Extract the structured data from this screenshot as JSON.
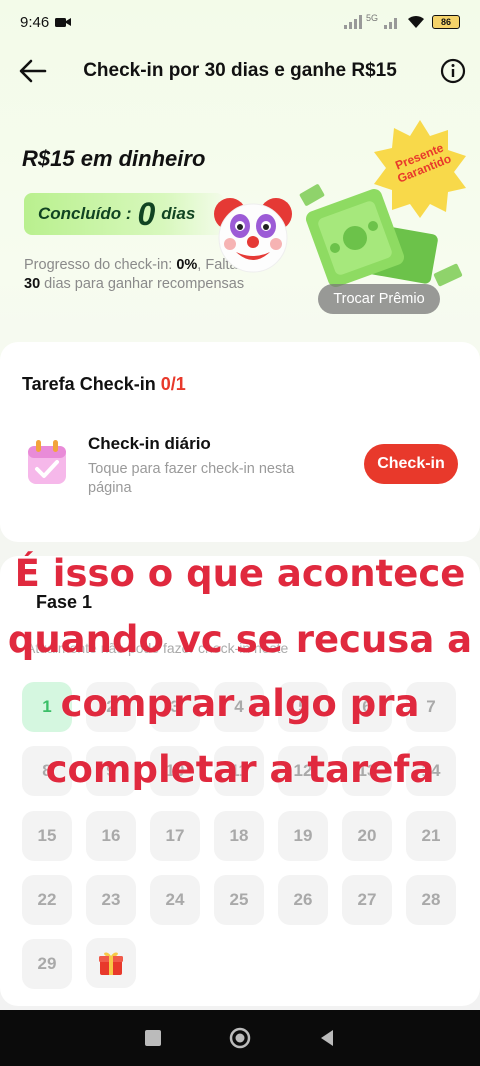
{
  "status_bar": {
    "time": "9:46",
    "battery": "86",
    "network": "5G"
  },
  "header": {
    "title": "Check-in por 30 dias e ganhe R$15"
  },
  "reward": {
    "title": "R$15 em dinheiro",
    "completed_label": "Concluído :",
    "completed_value": "0",
    "completed_unit": "dias",
    "progress_prefix": "Progresso do check-in:",
    "progress_value": "0%",
    "progress_suffix1": ", Faltam",
    "days_left": "30",
    "progress_suffix2": "dias para ganhar recompensas",
    "badge_line1": "Presente",
    "badge_line2": "Garantido",
    "trade_button": "Trocar Prêmio"
  },
  "task": {
    "title": "Tarefa Check-in",
    "count": "0/1",
    "name": "Check-in diário",
    "desc": "Toque para fazer check-in nesta página",
    "button": "Check-in"
  },
  "phase": {
    "title": "Fase 1",
    "note": "Atualmente não pode fazer check-in neste"
  },
  "days": [
    "1",
    "2",
    "3",
    "4",
    "5",
    "6",
    "7",
    "8",
    "9",
    "10",
    "11",
    "12",
    "13",
    "14",
    "15",
    "16",
    "17",
    "18",
    "19",
    "20",
    "21",
    "22",
    "23",
    "24",
    "25",
    "26",
    "27",
    "28",
    "29"
  ],
  "overlay": {
    "line1": "É isso o que acontece",
    "line2": "quando vc se recusa a",
    "line3": "comprar algo pra",
    "line4": "completar a tarefa"
  },
  "colors": {
    "accent_red": "#e8392b",
    "overlay_text": "#e0293e",
    "active_day": "#3bbf68"
  }
}
